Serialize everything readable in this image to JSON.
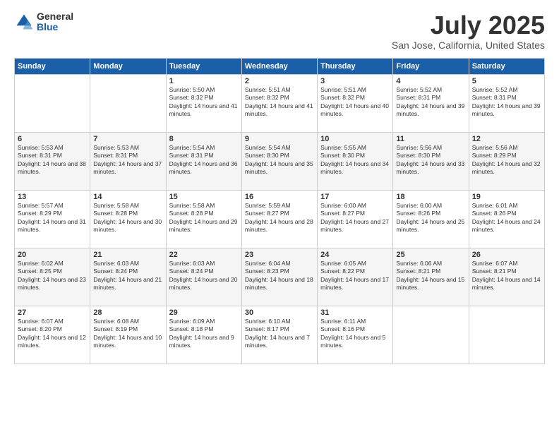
{
  "logo": {
    "general": "General",
    "blue": "Blue"
  },
  "title": "July 2025",
  "subtitle": "San Jose, California, United States",
  "days_of_week": [
    "Sunday",
    "Monday",
    "Tuesday",
    "Wednesday",
    "Thursday",
    "Friday",
    "Saturday"
  ],
  "weeks": [
    [
      {
        "day": "",
        "info": ""
      },
      {
        "day": "",
        "info": ""
      },
      {
        "day": "1",
        "info": "Sunrise: 5:50 AM\nSunset: 8:32 PM\nDaylight: 14 hours and 41 minutes."
      },
      {
        "day": "2",
        "info": "Sunrise: 5:51 AM\nSunset: 8:32 PM\nDaylight: 14 hours and 41 minutes."
      },
      {
        "day": "3",
        "info": "Sunrise: 5:51 AM\nSunset: 8:32 PM\nDaylight: 14 hours and 40 minutes."
      },
      {
        "day": "4",
        "info": "Sunrise: 5:52 AM\nSunset: 8:31 PM\nDaylight: 14 hours and 39 minutes."
      },
      {
        "day": "5",
        "info": "Sunrise: 5:52 AM\nSunset: 8:31 PM\nDaylight: 14 hours and 39 minutes."
      }
    ],
    [
      {
        "day": "6",
        "info": "Sunrise: 5:53 AM\nSunset: 8:31 PM\nDaylight: 14 hours and 38 minutes."
      },
      {
        "day": "7",
        "info": "Sunrise: 5:53 AM\nSunset: 8:31 PM\nDaylight: 14 hours and 37 minutes."
      },
      {
        "day": "8",
        "info": "Sunrise: 5:54 AM\nSunset: 8:31 PM\nDaylight: 14 hours and 36 minutes."
      },
      {
        "day": "9",
        "info": "Sunrise: 5:54 AM\nSunset: 8:30 PM\nDaylight: 14 hours and 35 minutes."
      },
      {
        "day": "10",
        "info": "Sunrise: 5:55 AM\nSunset: 8:30 PM\nDaylight: 14 hours and 34 minutes."
      },
      {
        "day": "11",
        "info": "Sunrise: 5:56 AM\nSunset: 8:30 PM\nDaylight: 14 hours and 33 minutes."
      },
      {
        "day": "12",
        "info": "Sunrise: 5:56 AM\nSunset: 8:29 PM\nDaylight: 14 hours and 32 minutes."
      }
    ],
    [
      {
        "day": "13",
        "info": "Sunrise: 5:57 AM\nSunset: 8:29 PM\nDaylight: 14 hours and 31 minutes."
      },
      {
        "day": "14",
        "info": "Sunrise: 5:58 AM\nSunset: 8:28 PM\nDaylight: 14 hours and 30 minutes."
      },
      {
        "day": "15",
        "info": "Sunrise: 5:58 AM\nSunset: 8:28 PM\nDaylight: 14 hours and 29 minutes."
      },
      {
        "day": "16",
        "info": "Sunrise: 5:59 AM\nSunset: 8:27 PM\nDaylight: 14 hours and 28 minutes."
      },
      {
        "day": "17",
        "info": "Sunrise: 6:00 AM\nSunset: 8:27 PM\nDaylight: 14 hours and 27 minutes."
      },
      {
        "day": "18",
        "info": "Sunrise: 6:00 AM\nSunset: 8:26 PM\nDaylight: 14 hours and 25 minutes."
      },
      {
        "day": "19",
        "info": "Sunrise: 6:01 AM\nSunset: 8:26 PM\nDaylight: 14 hours and 24 minutes."
      }
    ],
    [
      {
        "day": "20",
        "info": "Sunrise: 6:02 AM\nSunset: 8:25 PM\nDaylight: 14 hours and 23 minutes."
      },
      {
        "day": "21",
        "info": "Sunrise: 6:03 AM\nSunset: 8:24 PM\nDaylight: 14 hours and 21 minutes."
      },
      {
        "day": "22",
        "info": "Sunrise: 6:03 AM\nSunset: 8:24 PM\nDaylight: 14 hours and 20 minutes."
      },
      {
        "day": "23",
        "info": "Sunrise: 6:04 AM\nSunset: 8:23 PM\nDaylight: 14 hours and 18 minutes."
      },
      {
        "day": "24",
        "info": "Sunrise: 6:05 AM\nSunset: 8:22 PM\nDaylight: 14 hours and 17 minutes."
      },
      {
        "day": "25",
        "info": "Sunrise: 6:06 AM\nSunset: 8:21 PM\nDaylight: 14 hours and 15 minutes."
      },
      {
        "day": "26",
        "info": "Sunrise: 6:07 AM\nSunset: 8:21 PM\nDaylight: 14 hours and 14 minutes."
      }
    ],
    [
      {
        "day": "27",
        "info": "Sunrise: 6:07 AM\nSunset: 8:20 PM\nDaylight: 14 hours and 12 minutes."
      },
      {
        "day": "28",
        "info": "Sunrise: 6:08 AM\nSunset: 8:19 PM\nDaylight: 14 hours and 10 minutes."
      },
      {
        "day": "29",
        "info": "Sunrise: 6:09 AM\nSunset: 8:18 PM\nDaylight: 14 hours and 9 minutes."
      },
      {
        "day": "30",
        "info": "Sunrise: 6:10 AM\nSunset: 8:17 PM\nDaylight: 14 hours and 7 minutes."
      },
      {
        "day": "31",
        "info": "Sunrise: 6:11 AM\nSunset: 8:16 PM\nDaylight: 14 hours and 5 minutes."
      },
      {
        "day": "",
        "info": ""
      },
      {
        "day": "",
        "info": ""
      }
    ]
  ]
}
